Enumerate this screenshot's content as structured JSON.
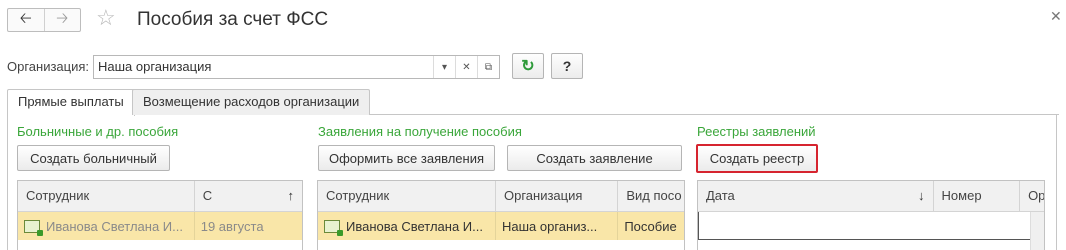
{
  "window": {
    "title": "Пособия за счет ФСС",
    "back_icon": "arrow-left-icon",
    "forward_icon": "arrow-right-icon",
    "favorite_icon": "star-icon",
    "close_icon": "close-icon"
  },
  "org": {
    "label": "Организация:",
    "value": "Наша организация",
    "help_label": "?"
  },
  "tabs": [
    {
      "label": "Прямые выплаты",
      "active": true
    },
    {
      "label": "Возмещение расходов организации",
      "active": false
    }
  ],
  "sections": {
    "sick": {
      "title": "Больничные и др. пособия",
      "create_button": "Создать больничный",
      "columns": [
        "Сотрудник",
        "С"
      ],
      "rows": [
        {
          "employee": "Иванова Светлана И...",
          "from": "19 августа"
        }
      ]
    },
    "applications": {
      "title": "Заявления на получение пособия",
      "issue_all_button": "Оформить все заявления",
      "create_button": "Создать заявление",
      "columns": [
        "Сотрудник",
        "Организация",
        "Вид посо"
      ],
      "rows": [
        {
          "employee": "Иванова Светлана И...",
          "organization": "Наша организ...",
          "kind": "Пособие"
        }
      ]
    },
    "registers": {
      "title": "Реестры заявлений",
      "create_button": "Создать реестр",
      "columns": [
        "Дата",
        "Номер",
        "Ор"
      ]
    }
  },
  "colors": {
    "section_title": "#3aa63a",
    "selected_row": "#f9e6a8",
    "highlight": "#d6242f"
  }
}
